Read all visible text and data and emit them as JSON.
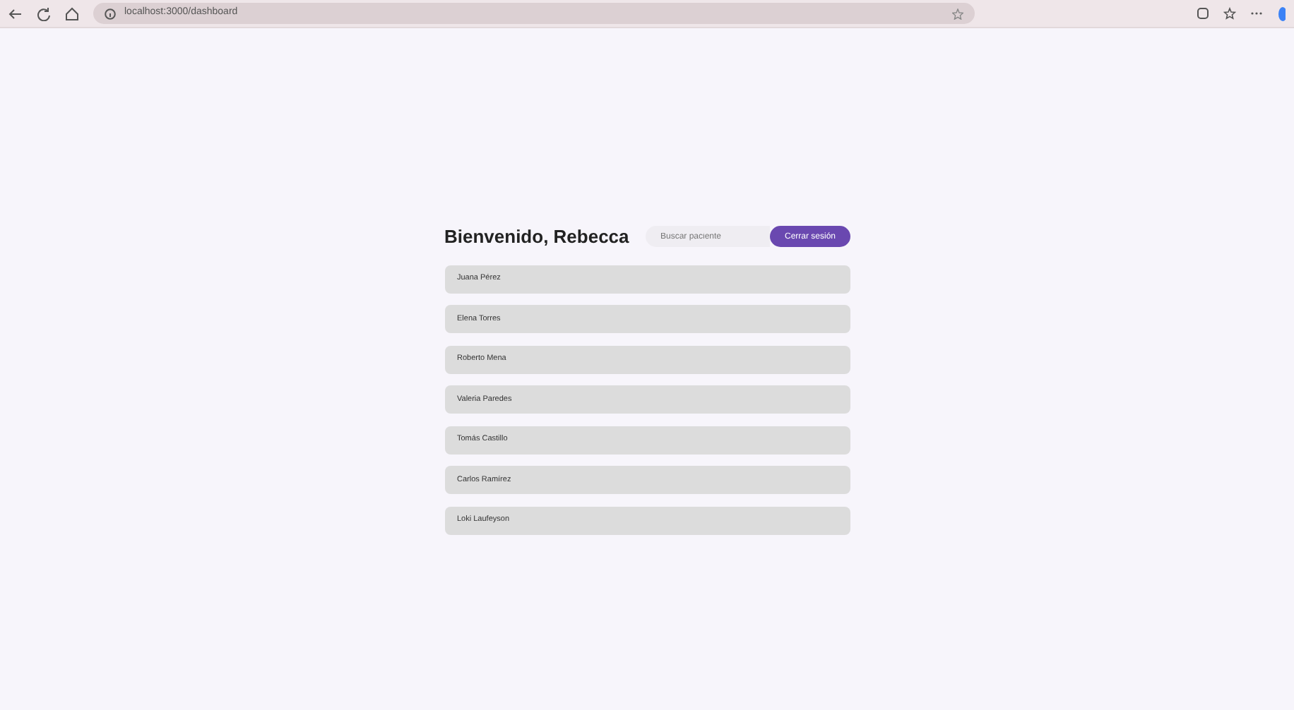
{
  "browser": {
    "address": "localhost:3000/dashboard"
  },
  "header": {
    "title": "Bienvenido, Rebecca",
    "search": {
      "placeholder": "Buscar paciente"
    },
    "logout_button": "Cerrar sesión"
  },
  "patients": [
    {
      "name": "Juana Pérez"
    },
    {
      "name": "Elena Torres"
    },
    {
      "name": "Roberto Mena"
    },
    {
      "name": "Valeria Paredes"
    },
    {
      "name": "Tomás Castillo"
    },
    {
      "name": "Carlos Ramírez"
    },
    {
      "name": "Loki Laufeyson"
    }
  ]
}
